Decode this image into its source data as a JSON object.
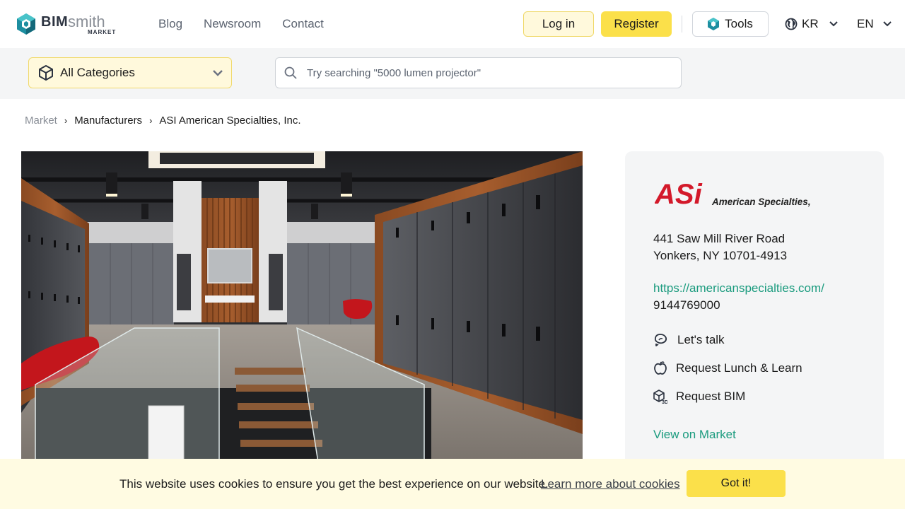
{
  "header": {
    "logo": {
      "bim": "BIM",
      "smith": "smith",
      "market": "MARKET"
    },
    "nav": [
      {
        "label": "Blog"
      },
      {
        "label": "Newsroom"
      },
      {
        "label": "Contact"
      }
    ],
    "login_label": "Log in",
    "register_label": "Register",
    "tools_label": "Tools",
    "country_label": "KR",
    "language_label": "EN"
  },
  "search": {
    "category_label": "All Categories",
    "placeholder": "Try searching \"5000 lumen projector\""
  },
  "breadcrumb": [
    {
      "label": "Market"
    },
    {
      "label": "Manufacturers"
    },
    {
      "label": "ASI American Specialties, Inc."
    }
  ],
  "manufacturer": {
    "logo_mark": "ASi",
    "logo_name": "American Specialties, Inc.",
    "address_line1": "441 Saw Mill River Road",
    "address_line2": "Yonkers, NY 10701-4913",
    "website": "https://americanspecialties.com/",
    "phone": "9144769000",
    "actions": [
      {
        "label": "Let's talk",
        "icon": "chat-icon"
      },
      {
        "label": "Request Lunch & Learn",
        "icon": "apple-icon"
      },
      {
        "label": "Request BIM",
        "icon": "bim-3d-icon"
      }
    ],
    "view_market_label": "View on Market"
  },
  "cookie": {
    "text": "This website uses cookies to ensure you get the best experience on our website.",
    "link_label": "Learn more about cookies",
    "button_label": "Got it!"
  },
  "colors": {
    "accent_yellow": "#fbe04a",
    "link_green": "#1a9b7e",
    "brand_red": "#d3192a"
  }
}
